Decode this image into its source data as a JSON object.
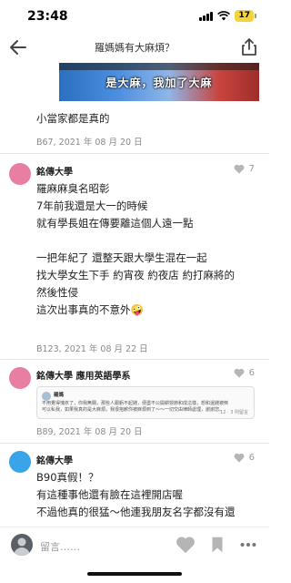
{
  "status": {
    "time": "23:48",
    "battery": "17"
  },
  "header": {
    "title": "羅媽媽有大麻煩？"
  },
  "banner": {
    "caption": "是大麻，我加了大麻"
  },
  "comments": [
    {
      "lines": [
        "小當家都是真的"
      ],
      "meta": "B67, 2021 年 08 月 20 日"
    },
    {
      "author": "銘傳大學",
      "likes": "7",
      "lines": [
        "羅麻麻臭名昭彰",
        "7年前我還是大一的時候",
        "就有學長姐在傳要離這個人遠一點",
        "",
        "一把年紀了 還整天跟大學生混在一起",
        "找大學女生下手 約宵夜 約夜店 約打麻將的",
        "然後性侵",
        "這次出事真的不意外🤪"
      ],
      "meta": "B123, 2021 年 08 月 22 日"
    },
    {
      "author": "銘傳大學 應用英語學系",
      "likes": "6",
      "quote": {
        "name": "羅媽",
        "lines": [
          "不用覺得愧疚了，你我無關，那些人跟虧不起錢，便盡不公開耕營節和成這樣，想和還錢被倒",
          "可以私我，如果我真的是大麻煩，我很抱歉你被麻煩到了～～一切交由律師處理，謝謝您。"
        ],
        "reactions": "12 · 3 則留言"
      },
      "meta": "B89, 2021 年 08 月 20 日"
    },
    {
      "author": "銘傳大學",
      "likes": "6",
      "lines": [
        "B90真假！？",
        "有這種事他還有臉在這裡開店喔",
        "不過他真的很猛～他連我朋友名字都沒有還"
      ]
    }
  ],
  "bottom_bar": {
    "comment_placeholder": "留言……"
  },
  "colors": {
    "avatar_pink": "#e87fa3",
    "avatar_blue": "#3aa4e8",
    "like_gray": "#b5b5b5"
  },
  "icons": [
    "back-arrow-icon",
    "share-icon",
    "heart-icon",
    "bookmark-icon",
    "more-icon"
  ]
}
